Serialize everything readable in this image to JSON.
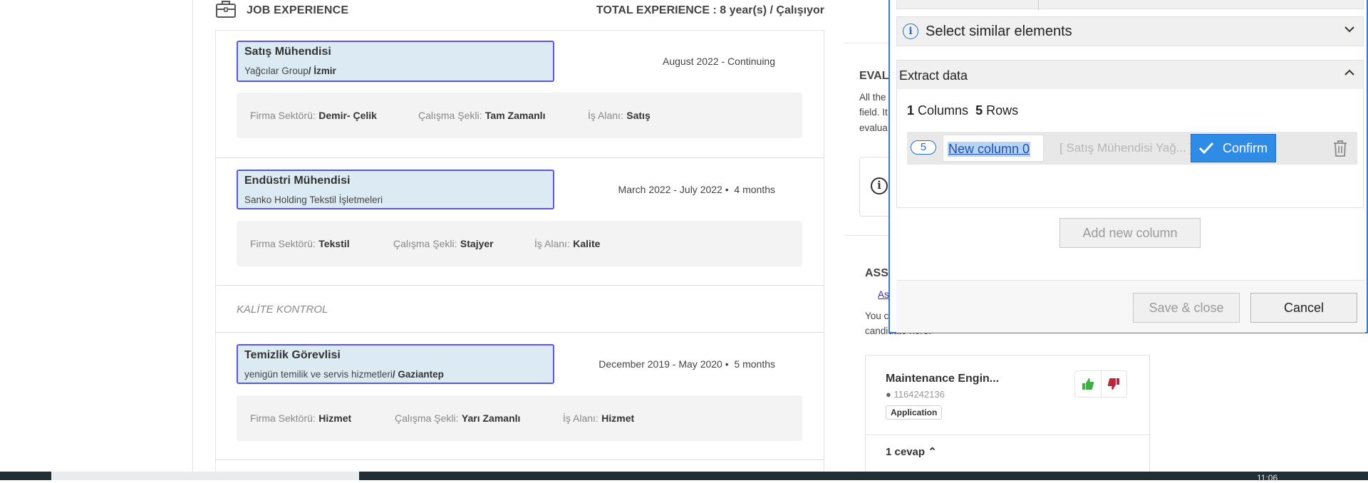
{
  "job_experience": {
    "section_title": "JOB EXPERIENCE",
    "total_experience": "TOTAL EXPERIENCE : 8 year(s) / Çalışıyor",
    "jobs": [
      {
        "title": "Satış Mühendisi",
        "company": "Yağcılar Group",
        "location": "/ İzmir",
        "dates": "August 2022 - Continuing",
        "duration": "",
        "sector_label": "Firma Sektörü:",
        "sector": "Demir- Çelik",
        "work_type_label": "Çalışma Şekli:",
        "work_type": "Tam Zamanlı",
        "area_label": "İş Alanı:",
        "area": "Satış"
      },
      {
        "title": "Endüstri Mühendisi",
        "company": "Sanko Holding Tekstil İşletmeleri",
        "location": "",
        "dates": "March 2022 - July 2022 •",
        "duration": "4 months",
        "sector_label": "Firma Sektörü:",
        "sector": "Tekstil",
        "work_type_label": "Çalışma Şekli:",
        "work_type": "Stajyer",
        "area_label": "İş Alanı:",
        "area": "Kalite"
      },
      {
        "title": "Temizlik Görevlisi",
        "company": "yenigün temilik ve servis hizmetleri",
        "location": "/ Gaziantep",
        "dates": "December 2019 - May 2020 •",
        "duration": "5 months",
        "sector_label": "Firma Sektörü:",
        "sector": "Hizmet",
        "work_type_label": "Çalışma Şekli:",
        "work_type": "Yarı Zamanlı",
        "area_label": "İş Alanı:",
        "area": "Hizmet"
      }
    ],
    "note": "KALİTE KONTROL"
  },
  "right_panel": {
    "eval_heading": "EVAL",
    "eval_line1": "All the",
    "eval_line2": "field. It",
    "eval_line3": "evalua",
    "assess_heading": "ASS",
    "assess_link": "As",
    "assess_line1": "You c",
    "assess_line2": "candidate here.",
    "card": {
      "name": "Maintenance Engin...",
      "id": "1164242136",
      "tag": "Application",
      "answers": "1 cevap"
    }
  },
  "dialog": {
    "select_similar": "Select similar elements",
    "extract_data": "Extract data",
    "columns_count": "1",
    "columns_label": "Columns",
    "rows_count": "5",
    "rows_label": "Rows",
    "column_badge": "5",
    "column_name": "New column 0",
    "column_preview": "[ Satış Mühendisi Yağ... ]",
    "confirm": "Confirm",
    "add_column": "Add new column",
    "save_close": "Save & close",
    "cancel": "Cancel"
  },
  "taskbar": {
    "clock": "11:06"
  },
  "colors": {
    "accent_blue": "#2e8be6",
    "highlight_border": "#5a57e0",
    "highlight_fill": "#dcebf3"
  }
}
